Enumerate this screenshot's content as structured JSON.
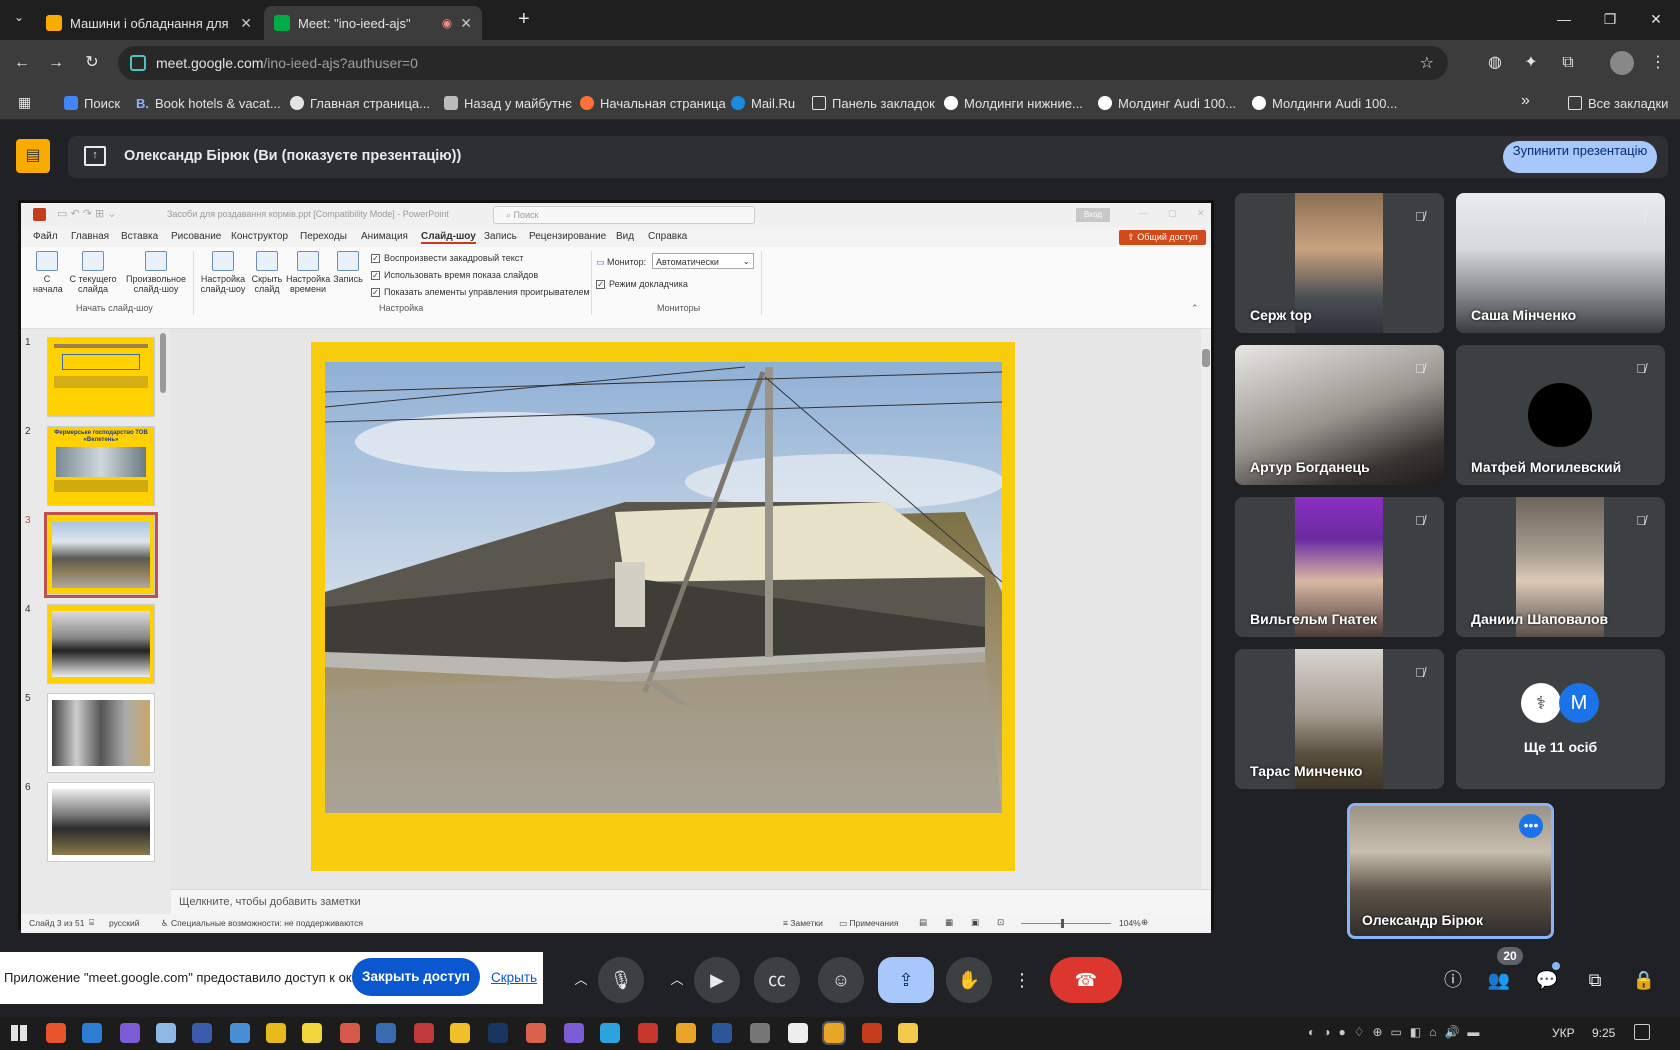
{
  "browser": {
    "tabs": [
      {
        "title": "Машини і обладнання для тва",
        "favicon_color": "#f9ab00",
        "active": false
      },
      {
        "title": "Meet: \"ino-ieed-ajs\"",
        "favicon_color": "#00ac47",
        "active": true
      }
    ],
    "new_tab": "+",
    "url_host": "meet.google.com",
    "url_path": "/ino-ieed-ajs?authuser=0",
    "bookmarks": [
      {
        "label": "Поиск",
        "color": "#4285f4"
      },
      {
        "label": "Book hotels & vacat...",
        "color": "#003580",
        "prefix": "B."
      },
      {
        "label": "Главная страница...",
        "color": "#ffffff"
      },
      {
        "label": "Назад у майбутнє",
        "color": "#ffffff"
      },
      {
        "label": "Начальная страница",
        "color": "#ff7139"
      },
      {
        "label": "Mail.Ru",
        "color": "#168de2"
      },
      {
        "label": "Панель закладок",
        "color": "#e3e3e3"
      },
      {
        "label": "Молдинги нижние...",
        "color": "#ffffff"
      },
      {
        "label": "Молдинг Audi 100...",
        "color": "#ffffff"
      },
      {
        "label": "Молдинги Audi 100...",
        "color": "#ffffff"
      }
    ],
    "all_bookmarks": "Все закладки"
  },
  "meet": {
    "presenter_banner": "Олександр Бірюк (Ви (показуєте презентацію))",
    "stop_button": "Зупинити презентацію",
    "participants": [
      {
        "name": "Серж top"
      },
      {
        "name": "Саша Мінченко"
      },
      {
        "name": "Артур Богданець"
      },
      {
        "name": "Матфей Могилевский"
      },
      {
        "name": "Вильгельм Гнатек"
      },
      {
        "name": "Даниил Шаповалов"
      },
      {
        "name": "Тарас Минченко"
      },
      {
        "name": "Ще 11 осіб",
        "avatar_letter": "M",
        "avatar_color": "#1a73e8"
      }
    ],
    "self_tile": "Олександр Бірюк",
    "participant_count": "20",
    "share_notice": "Приложение \"meet.google.com\" предоставило доступ к окну.",
    "close_access": "Закрыть доступ",
    "hide": "Скрыть",
    "end_call_color": "#dc362e"
  },
  "ppt": {
    "title": "Засоби для роздавання кормів.ppt [Compatibility Mode] - PowerPoint",
    "search": "Поиск",
    "signin": "Вход",
    "share": "Общий доступ",
    "menus": [
      "Файл",
      "Главная",
      "Вставка",
      "Рисование",
      "Конструктор",
      "Переходы",
      "Анимация",
      "Слайд-шоу",
      "Запись",
      "Рецензирование",
      "Вид",
      "Справка"
    ],
    "ribbon_buttons": [
      {
        "label": "С начала"
      },
      {
        "label": "С текущего слайда"
      },
      {
        "label": "Произвольное слайд-шоу"
      },
      {
        "label": "Настройка слайд-шоу"
      },
      {
        "label": "Скрыть слайд"
      },
      {
        "label": "Настройка времени"
      },
      {
        "label": "Запись"
      }
    ],
    "checks": [
      "Воспроизвести закадровый текст",
      "Использовать время показа слайдов",
      "Показать элементы управления проигрывателем"
    ],
    "monitor_label": "Монитор:",
    "monitor_value": "Автоматически",
    "presenter_view": "Режим докладчика",
    "groups": [
      "Начать слайд-шоу",
      "Настройка",
      "Мониторы"
    ],
    "slide_numbers": [
      "1",
      "2",
      "3",
      "4",
      "5",
      "6"
    ],
    "thumb2_title": "Фермерське господарство ТОВ «Велетень»",
    "notes_placeholder": "Щелкните, чтобы добавить заметки",
    "status_slide": "Слайд 3 из 51",
    "status_lang": "русский",
    "status_access": "Специальные возможности: не поддерживаются",
    "status_notes": "Заметки",
    "status_comments": "Примечания",
    "zoom": "104%"
  },
  "taskbar": {
    "lang": "УКР",
    "time": "9:25"
  }
}
